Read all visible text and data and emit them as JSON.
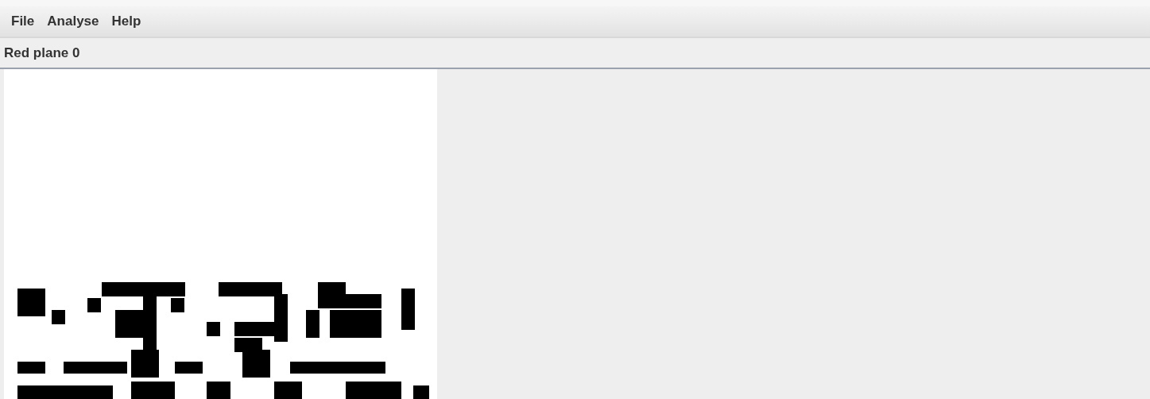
{
  "menu_bar": {
    "items": [
      {
        "label": "File"
      },
      {
        "label": "Analyse"
      },
      {
        "label": "Help"
      }
    ]
  },
  "plane_label": "Red plane 0"
}
